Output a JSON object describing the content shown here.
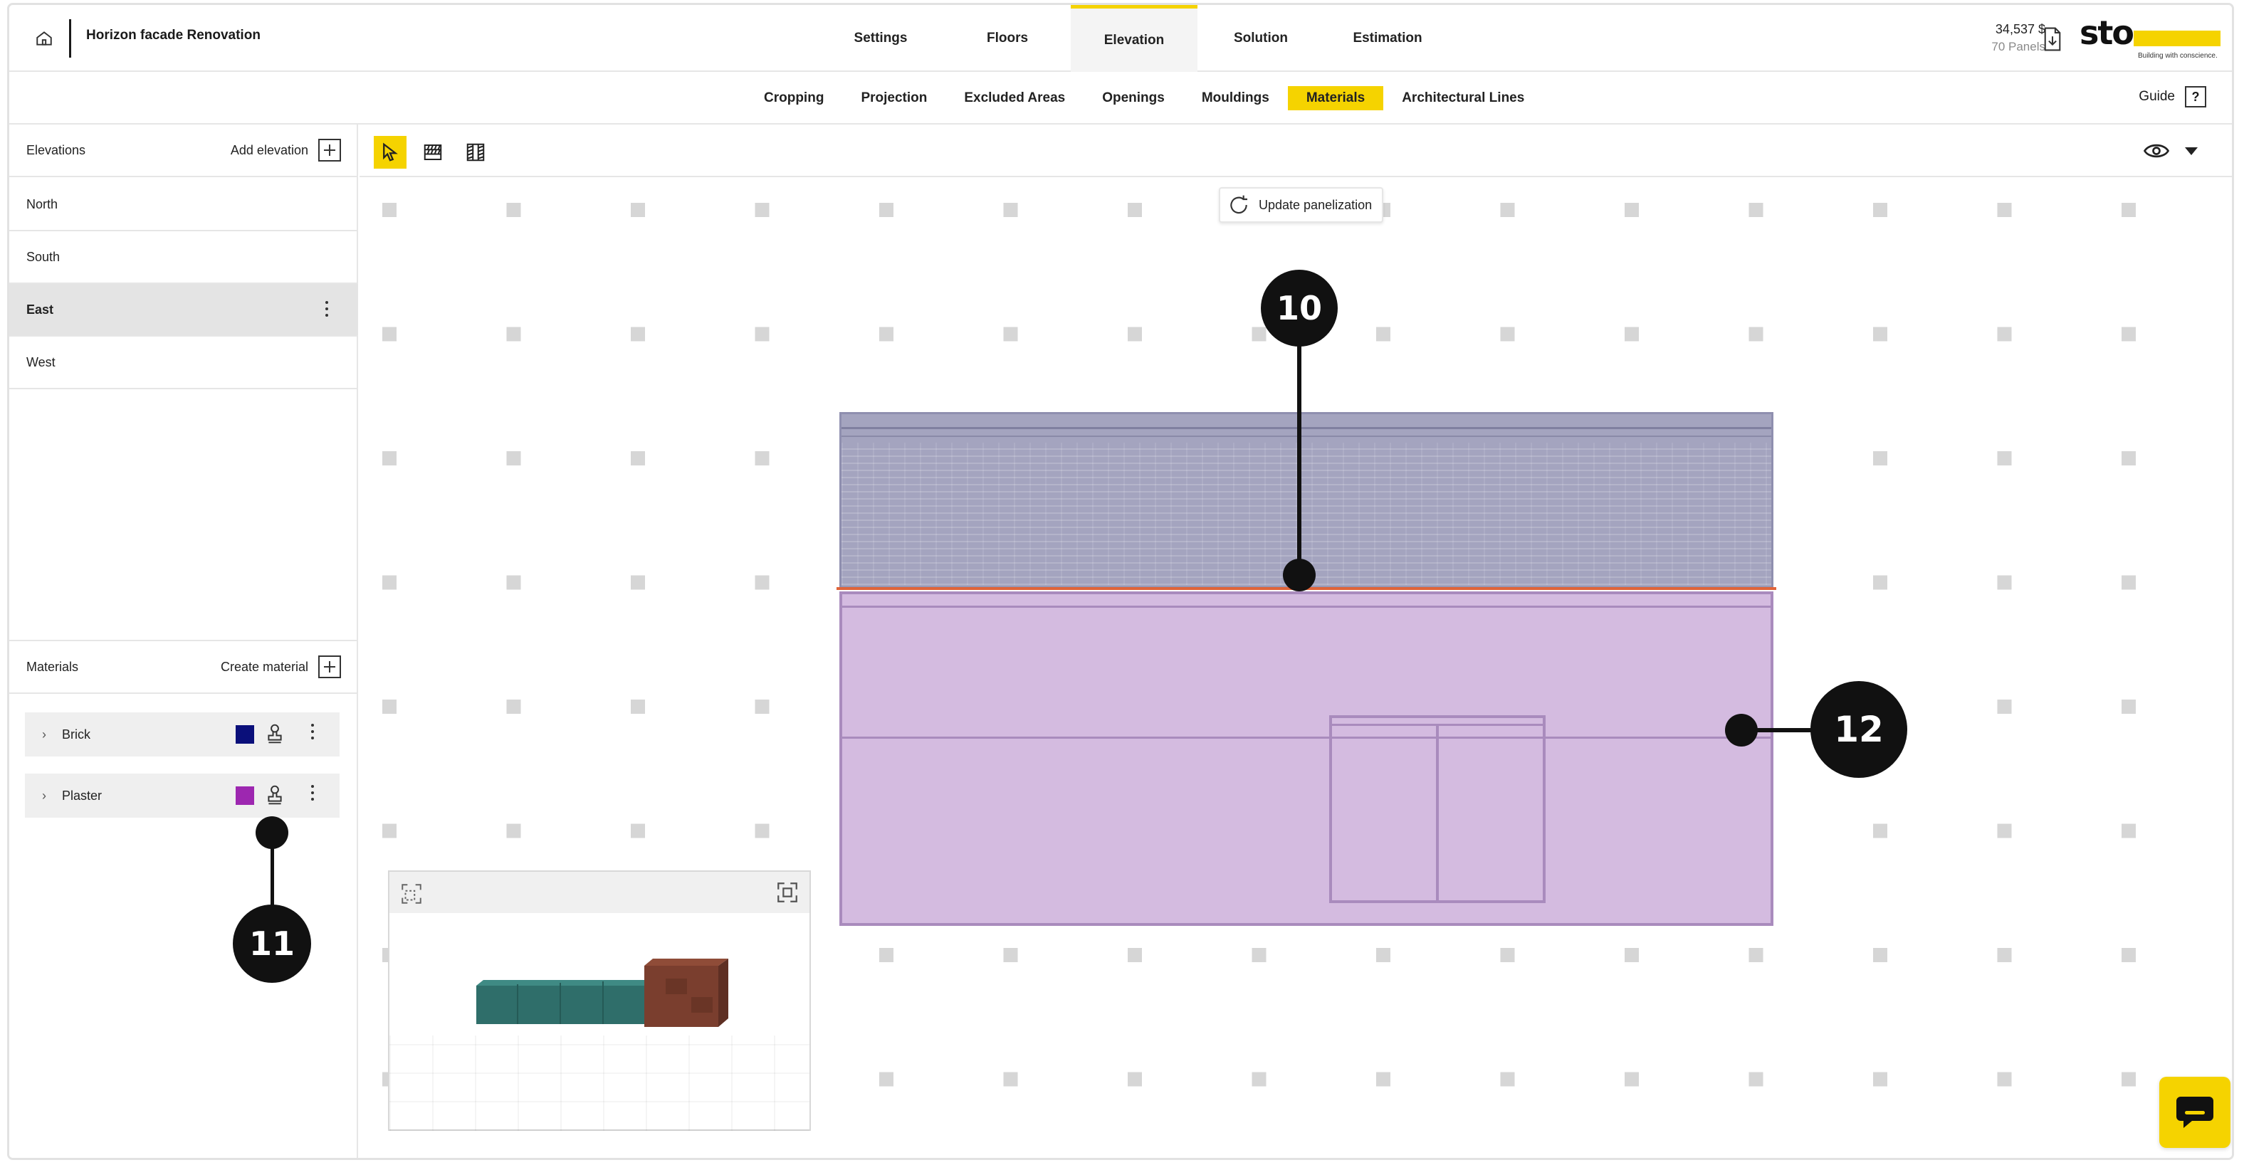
{
  "header": {
    "project_title": "Horizon facade Renovation",
    "tabs": [
      {
        "label": "Settings"
      },
      {
        "label": "Floors"
      },
      {
        "label": "Elevation"
      },
      {
        "label": "Solution"
      },
      {
        "label": "Estimation"
      }
    ],
    "active_tab": "Elevation",
    "price": "34,537 $",
    "panels": "70 Panels",
    "logo_text": "sto",
    "logo_tagline": "Building with conscience."
  },
  "subnav": {
    "tabs": [
      {
        "label": "Cropping"
      },
      {
        "label": "Projection"
      },
      {
        "label": "Excluded Areas"
      },
      {
        "label": "Openings"
      },
      {
        "label": "Mouldings"
      },
      {
        "label": "Materials"
      },
      {
        "label": "Architectural Lines"
      }
    ],
    "active_tab": "Materials",
    "guide_label": "Guide",
    "guide_icon": "?"
  },
  "elevations": {
    "title": "Elevations",
    "add_label": "Add elevation",
    "items": [
      {
        "label": "North"
      },
      {
        "label": "South"
      },
      {
        "label": "East"
      },
      {
        "label": "West"
      }
    ],
    "active": "East"
  },
  "materials": {
    "title": "Materials",
    "create_label": "Create material",
    "items": [
      {
        "label": "Brick",
        "color": "#0a0f7a"
      },
      {
        "label": "Plaster",
        "color": "#9d27b0"
      }
    ]
  },
  "canvas": {
    "update_label": "Update panelization",
    "upper_wall_color": "#a4a4bf",
    "lower_wall_color": "#d4bbe0",
    "highlight_line_color": "#e0643a"
  },
  "callouts": {
    "c10": "10",
    "c11": "11",
    "c12": "12"
  },
  "accent_color": "#f5d300"
}
